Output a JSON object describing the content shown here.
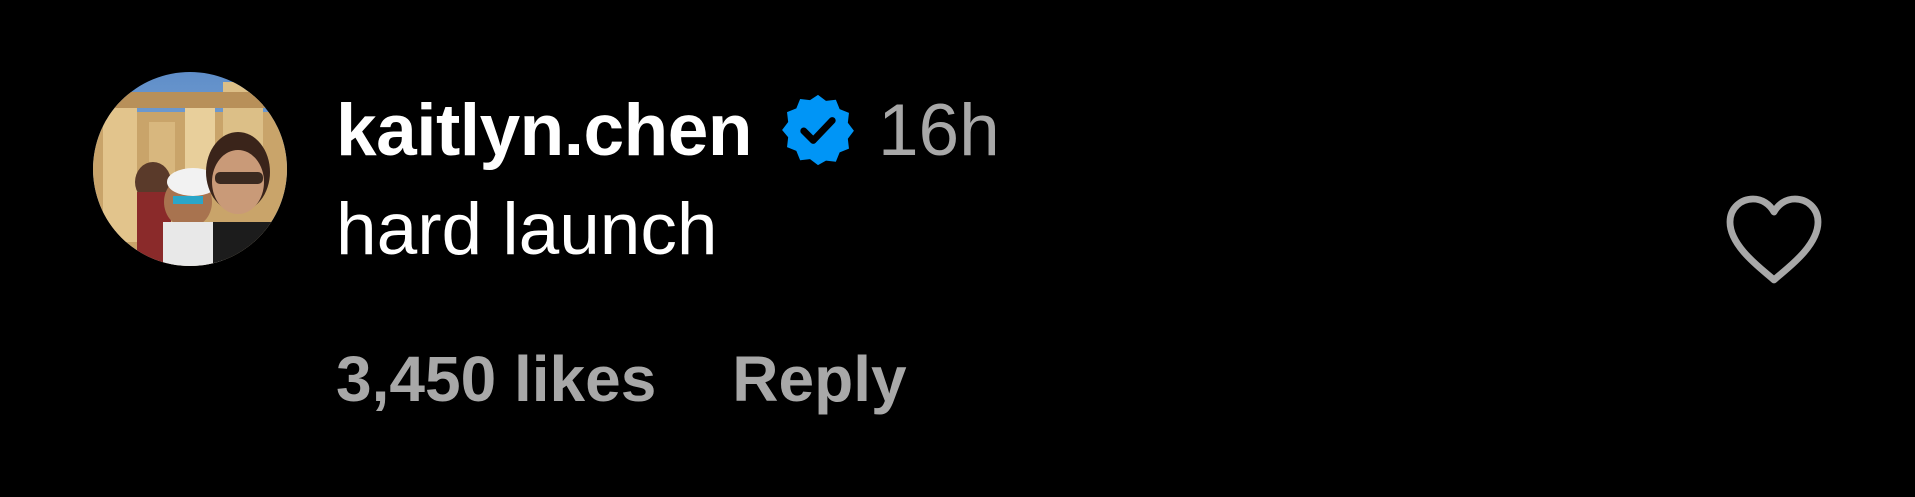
{
  "comment": {
    "avatar_icon": "user-avatar-photo",
    "username": "kaitlyn.chen",
    "verified_icon": "verified-badge-icon",
    "timestamp": "16h",
    "text": "hard launch",
    "likes_label": "3,450 likes",
    "reply_label": "Reply",
    "like_icon": "heart-outline-icon"
  },
  "colors": {
    "background": "#000000",
    "primary_text": "#ffffff",
    "secondary_text": "#a8a8a8",
    "verified_blue": "#0095f6"
  }
}
